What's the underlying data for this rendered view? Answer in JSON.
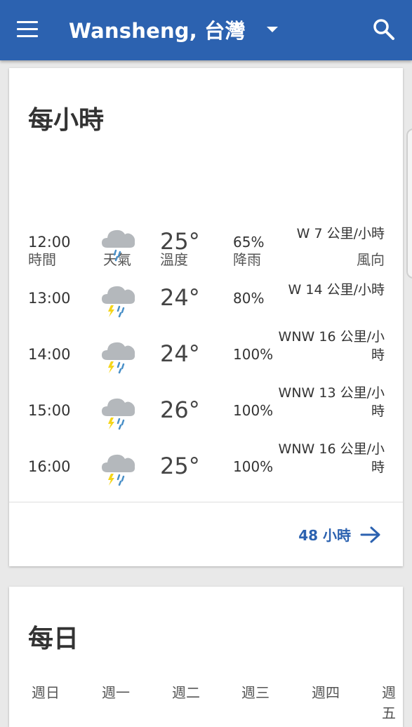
{
  "appbar": {
    "location": "Wansheng, 台灣"
  },
  "hourly": {
    "title": "每小時",
    "headers": {
      "time": "時間",
      "weather": "天氣",
      "temp": "溫度",
      "rain": "降雨",
      "wind": "風向"
    },
    "rows": [
      {
        "time": "12:00",
        "icon": "rain-cloud-icon",
        "temp": "25°",
        "rain": "65%",
        "wind": "W 7 公里/小時"
      },
      {
        "time": "13:00",
        "icon": "thunderstorm-icon",
        "temp": "24°",
        "rain": "80%",
        "wind": "W 14 公里/小時"
      },
      {
        "time": "14:00",
        "icon": "thunderstorm-icon",
        "temp": "24°",
        "rain": "100%",
        "wind": "WNW 16 公里/小時"
      },
      {
        "time": "15:00",
        "icon": "thunderstorm-icon",
        "temp": "26°",
        "rain": "100%",
        "wind": "WNW 13 公里/小時"
      },
      {
        "time": "16:00",
        "icon": "thunderstorm-icon",
        "temp": "25°",
        "rain": "100%",
        "wind": "WNW 16 公里/小時"
      }
    ],
    "more_label": "48 小時"
  },
  "daily": {
    "title": "每日",
    "days": [
      "週日",
      "週一",
      "週二",
      "週三",
      "週四",
      "週五"
    ]
  },
  "colors": {
    "appbar": "#2c62b0",
    "link": "#2c62b0",
    "cloud": "#b4b8bc",
    "rain_drop": "#4a90c8",
    "lightning": "#f5d51a"
  }
}
